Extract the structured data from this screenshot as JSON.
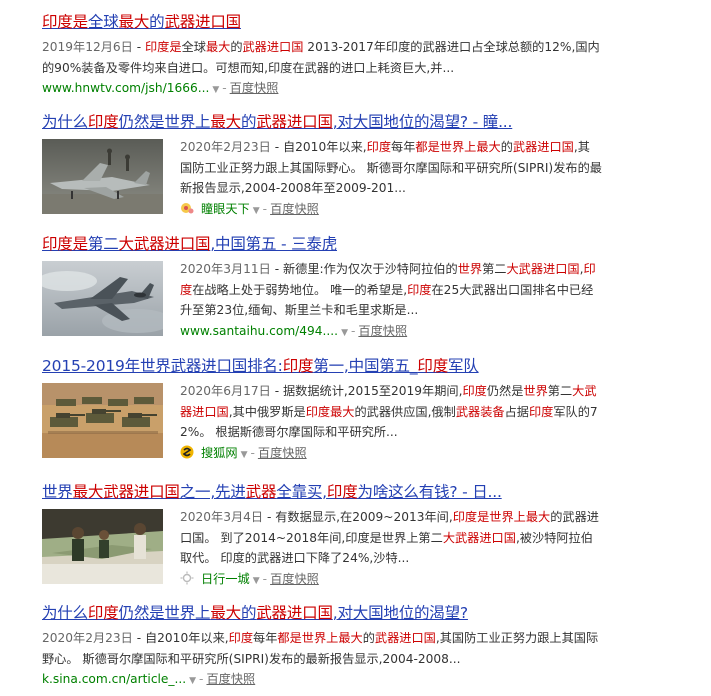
{
  "results": [
    {
      "title": [
        {
          "t": "印度是",
          "hl": true
        },
        {
          "t": "全球",
          "hl": false
        },
        {
          "t": "最大",
          "hl": true
        },
        {
          "t": "的",
          "hl": false
        },
        {
          "t": "武器进口国",
          "hl": true
        }
      ],
      "date": "2019年12月6日",
      "snippet": [
        {
          "t": " - ",
          "hl": false
        },
        {
          "t": "印度是",
          "hl": true
        },
        {
          "t": "全球",
          "hl": false
        },
        {
          "t": "最大",
          "hl": true
        },
        {
          "t": "的",
          "hl": false
        },
        {
          "t": "武器进口国",
          "hl": true
        },
        {
          "t": " 2013-2017年印度的武器进口占全球总额的12%,国内的90%装备及零件均来自进口。可想而知,印度在武器的进口上耗资巨大,并...",
          "hl": false
        }
      ],
      "url": "www.hnwtv.com/jsh/1666...",
      "cache_label": "百度快照"
    },
    {
      "title": [
        {
          "t": "为什么",
          "hl": false
        },
        {
          "t": "印度",
          "hl": true
        },
        {
          "t": "仍然是世界上",
          "hl": false
        },
        {
          "t": "最大",
          "hl": true
        },
        {
          "t": "的",
          "hl": false
        },
        {
          "t": "武器进口国",
          "hl": true
        },
        {
          "t": ",对大国地位的渴望? - 瞳...",
          "hl": false
        }
      ],
      "date": "2020年2月23日",
      "snippet": [
        {
          "t": " - 自2010年以来,",
          "hl": false
        },
        {
          "t": "印度",
          "hl": true
        },
        {
          "t": "每年",
          "hl": false
        },
        {
          "t": "都是世界上最大",
          "hl": true
        },
        {
          "t": "的",
          "hl": false
        },
        {
          "t": "武器进口国",
          "hl": true
        },
        {
          "t": ",其国防工业正努力跟上其国际野心。 斯德哥尔摩国际和平研究所(SIPRI)发布的最新报告显示,2004-2008年至2009-201...",
          "hl": false
        }
      ],
      "source_name": "瞳眼天下",
      "cache_label": "百度快照"
    },
    {
      "title": [
        {
          "t": "印度是",
          "hl": true
        },
        {
          "t": "第二",
          "hl": false
        },
        {
          "t": "大武器进口国",
          "hl": true
        },
        {
          "t": ",中国第五 - 三泰虎",
          "hl": false
        }
      ],
      "date": "2020年3月11日",
      "snippet": [
        {
          "t": " - 新德里:作为仅次于沙特阿拉伯的",
          "hl": false
        },
        {
          "t": "世界",
          "hl": true
        },
        {
          "t": "第二",
          "hl": false
        },
        {
          "t": "大武器进口国",
          "hl": true
        },
        {
          "t": ",",
          "hl": false
        },
        {
          "t": "印度",
          "hl": true
        },
        {
          "t": "在战略上处于弱势地位。 唯一的希望是,",
          "hl": false
        },
        {
          "t": "印度",
          "hl": true
        },
        {
          "t": "在25大武器出口国排名中已经升至第23位,缅甸、斯里兰卡和毛里求斯是...",
          "hl": false
        }
      ],
      "url": "www.santaihu.com/494....",
      "cache_label": "百度快照"
    },
    {
      "title": [
        {
          "t": "2015-2019年世界武器进口国排名:",
          "hl": false
        },
        {
          "t": "印度",
          "hl": true
        },
        {
          "t": "第一,中国第五_",
          "hl": false
        },
        {
          "t": "印度",
          "hl": true
        },
        {
          "t": "军队",
          "hl": false
        }
      ],
      "date": "2020年6月17日",
      "snippet": [
        {
          "t": " - 据数据统计,2015至2019年期间,",
          "hl": false
        },
        {
          "t": "印度",
          "hl": true
        },
        {
          "t": "仍然是",
          "hl": false
        },
        {
          "t": "世界",
          "hl": true
        },
        {
          "t": "第二",
          "hl": false
        },
        {
          "t": "大武器进口国",
          "hl": true
        },
        {
          "t": ",其中俄罗斯是",
          "hl": false
        },
        {
          "t": "印度最大",
          "hl": true
        },
        {
          "t": "的武器供应国,俄制",
          "hl": false
        },
        {
          "t": "武器装备",
          "hl": true
        },
        {
          "t": "占据",
          "hl": false
        },
        {
          "t": "印度",
          "hl": true
        },
        {
          "t": "军队的72%。 根据斯德哥尔摩国际和平研究所...",
          "hl": false
        }
      ],
      "source_name": "搜狐网",
      "cache_label": "百度快照"
    },
    {
      "title": [
        {
          "t": "世界",
          "hl": false
        },
        {
          "t": "最大武器进口国",
          "hl": true
        },
        {
          "t": "之一,先进",
          "hl": false
        },
        {
          "t": "武器",
          "hl": true
        },
        {
          "t": "全靠买,",
          "hl": false
        },
        {
          "t": "印度",
          "hl": true
        },
        {
          "t": "为啥这么有钱? - 日...",
          "hl": false
        }
      ],
      "date": "2020年3月4日",
      "snippet": [
        {
          "t": " - 有数据显示,在2009~2013年间,",
          "hl": false
        },
        {
          "t": "印度是世界上最大",
          "hl": true
        },
        {
          "t": "的武器进口国。 到了2014~2018年间,印度是世界上第二",
          "hl": false
        },
        {
          "t": "大武器进口国",
          "hl": true
        },
        {
          "t": ",被沙特阿拉伯取代。 印度的武器进口下降了24%,沙特...",
          "hl": false
        }
      ],
      "source_name": "日行一城",
      "cache_label": "百度快照"
    },
    {
      "title": [
        {
          "t": "为什么",
          "hl": false
        },
        {
          "t": "印度",
          "hl": true
        },
        {
          "t": "仍然是世界上",
          "hl": false
        },
        {
          "t": "最大",
          "hl": true
        },
        {
          "t": "的",
          "hl": false
        },
        {
          "t": "武器进口国",
          "hl": true
        },
        {
          "t": ",对大国地位的渴望?",
          "hl": false
        }
      ],
      "date": "2020年2月23日",
      "snippet": [
        {
          "t": " - 自2010年以来,",
          "hl": false
        },
        {
          "t": "印度",
          "hl": true
        },
        {
          "t": "每年",
          "hl": false
        },
        {
          "t": "都是世界上最大",
          "hl": true
        },
        {
          "t": "的",
          "hl": false
        },
        {
          "t": "武器进口国",
          "hl": true
        },
        {
          "t": ",其国防工业正努力跟上其国际野心。 斯德哥尔摩国际和平研究所(SIPRI)发布的最新报告显示,2004-2008...",
          "hl": false
        }
      ],
      "url": "k.sina.com.cn/article_...",
      "cache_label": "百度快照"
    }
  ],
  "colors": {
    "title_link": "#2440b3",
    "highlight": "#cc0000",
    "url_green": "#008000"
  },
  "icons": {
    "result_2_source": "eye-logo-icon",
    "result_4_source": "sohu-logo-icon",
    "result_5_source": "sun-logo-icon"
  }
}
